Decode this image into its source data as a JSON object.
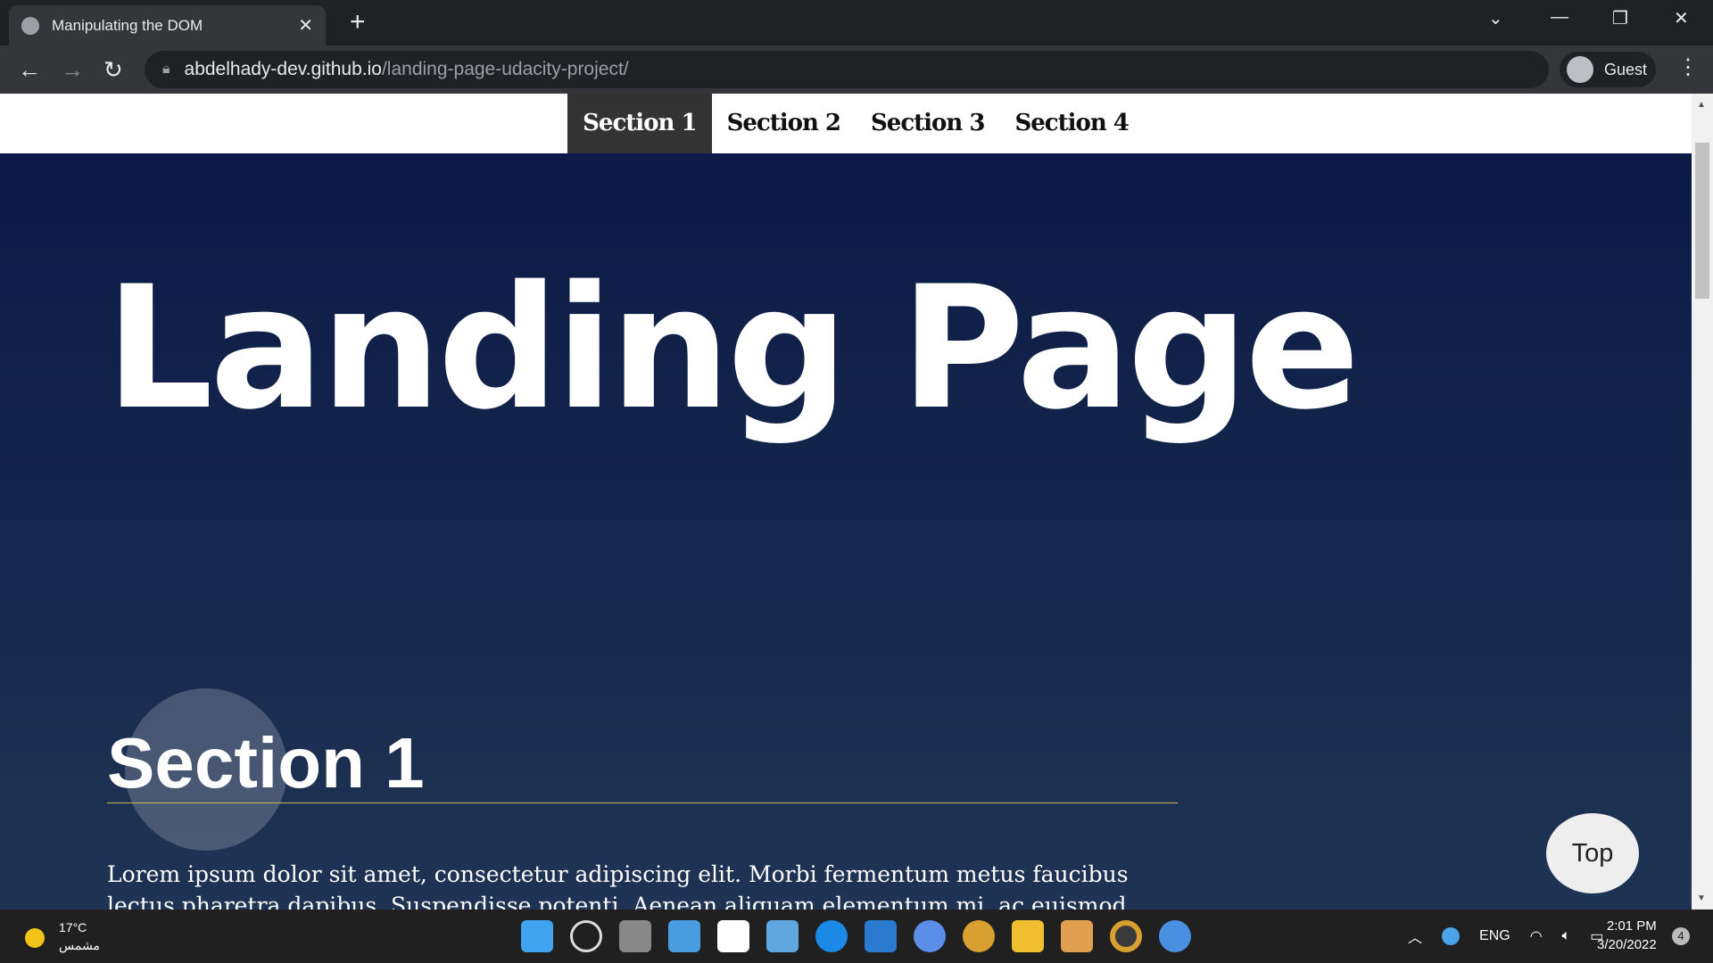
{
  "browser": {
    "tab_title": "Manipulating the DOM",
    "url_host": "abdelhady-dev.github.io",
    "url_path": "/landing-page-udacity-project/",
    "profile": "Guest"
  },
  "nav": {
    "items": [
      "Section 1",
      "Section 2",
      "Section 3",
      "Section 4"
    ],
    "active": 0
  },
  "hero": {
    "title": "Landing Page"
  },
  "section": {
    "heading": "Section 1",
    "paragraph": "Lorem ipsum dolor sit amet, consectetur adipiscing elit. Morbi fermentum metus faucibus lectus pharetra dapibus. Suspendisse potenti. Aenean aliquam elementum mi, ac euismod augue. Donec eget"
  },
  "top_button": "Top",
  "taskbar": {
    "temp": "17°C",
    "weather": "مشمس",
    "lang": "ENG",
    "time": "2:01 PM",
    "date": "3/20/2022",
    "notifications": "4"
  }
}
